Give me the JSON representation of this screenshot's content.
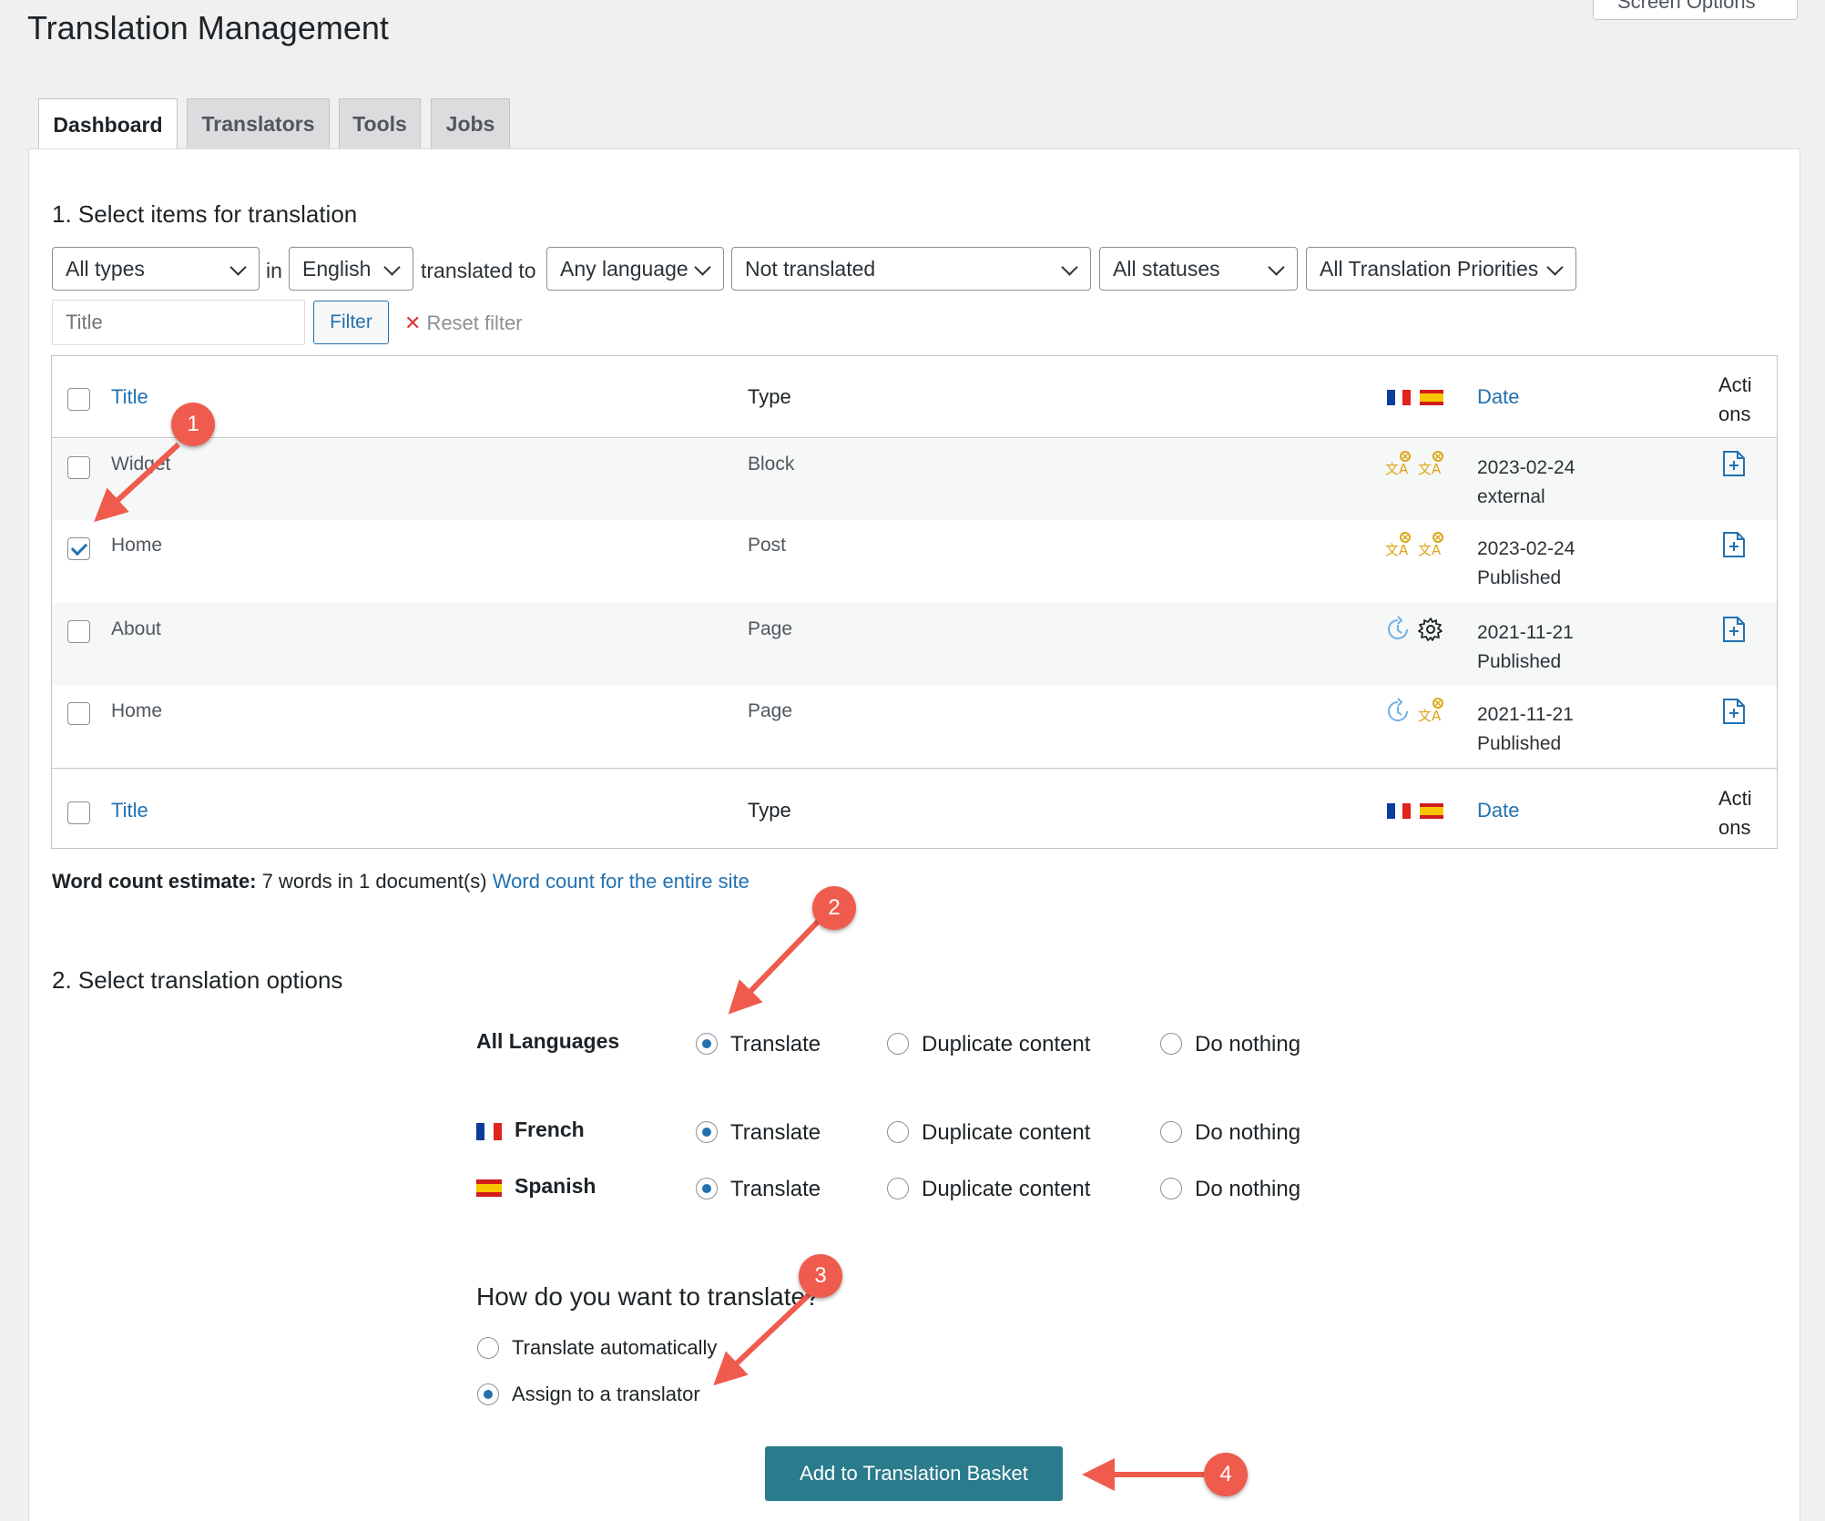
{
  "page": {
    "title": "Translation Management",
    "screen_options_label": "Screen Options"
  },
  "tabs": [
    {
      "label": "Dashboard"
    },
    {
      "label": "Translators"
    },
    {
      "label": "Tools"
    },
    {
      "label": "Jobs"
    }
  ],
  "section1": {
    "title": "1. Select items for translation",
    "filters": {
      "type": "All types",
      "in_label": "in",
      "source_language": "English",
      "translated_to_label": "translated to",
      "target_language": "Any language",
      "translation_status": "Not translated",
      "post_status": "All statuses",
      "priority": "All Translation Priorities"
    },
    "title_placeholder": "Title",
    "filter_button": "Filter",
    "reset_filter": "Reset filter",
    "reset_icon": "close-icon"
  },
  "table": {
    "columns": {
      "title": "Title",
      "type": "Type",
      "date": "Date",
      "actions_line1": "Acti",
      "actions_line2": "ons"
    },
    "rows": [
      {
        "title": "Widget",
        "type": "Block",
        "date": "2023-02-24",
        "status": "external",
        "checked": false,
        "fr_icon": "needs-translation-icon",
        "es_icon": "needs-translation-icon"
      },
      {
        "title": "Home",
        "type": "Post",
        "date": "2023-02-24",
        "status": "Published",
        "checked": true,
        "fr_icon": "needs-translation-icon",
        "es_icon": "needs-translation-icon"
      },
      {
        "title": "About",
        "type": "Page",
        "date": "2021-11-21",
        "status": "Published",
        "checked": false,
        "fr_icon": "in-progress-icon",
        "es_icon": "gear-icon"
      },
      {
        "title": "Home",
        "type": "Page",
        "date": "2021-11-21",
        "status": "Published",
        "checked": false,
        "fr_icon": "in-progress-icon",
        "es_icon": "needs-translation-icon"
      }
    ]
  },
  "word_count": {
    "label": "Word count estimate:",
    "value": "7 words in 1 document(s)",
    "link": "Word count for the entire site"
  },
  "section2": {
    "title": "2. Select translation options",
    "option_labels": {
      "translate": "Translate",
      "duplicate": "Duplicate content",
      "nothing": "Do nothing"
    },
    "languages": [
      {
        "label": "All Languages",
        "selected": "translate"
      },
      {
        "label": "French",
        "selected": "translate"
      },
      {
        "label": "Spanish",
        "selected": "translate"
      }
    ],
    "how_title": "How do you want to translate?",
    "how_options": [
      {
        "label": "Translate automatically",
        "selected": false
      },
      {
        "label": "Assign to a translator",
        "selected": true
      }
    ],
    "submit_button": "Add to Translation Basket"
  },
  "annotations": [
    "1",
    "2",
    "3",
    "4"
  ],
  "colors": {
    "accent": "#2271b1",
    "button": "#2a7b8c",
    "annotation": "#ef5b4c",
    "icon_orange": "#dba617"
  }
}
